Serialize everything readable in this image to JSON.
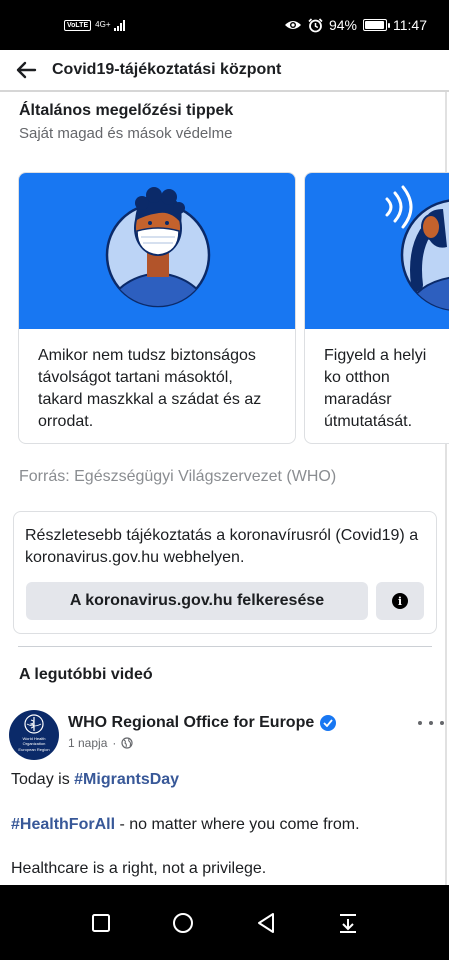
{
  "status_bar": {
    "volte": "VoLTE",
    "network": "4G+",
    "battery": "94%",
    "battery_level": 0.94,
    "time": "11:47"
  },
  "header": {
    "title": "Covid19-tájékoztatási központ",
    "back_icon": "arrow-left-icon"
  },
  "prevention": {
    "title": "Általános megelőzési tippek",
    "subtitle": "Saját magad és mások védelme",
    "cards": [
      {
        "text": "Amikor nem tudsz biztonságos távolságot tartani másoktól, takard maszkkal a szádat és az orrodat.",
        "illustration": "masked-person"
      },
      {
        "text": "Figyeld a helyi ko otthon maradásr útmutatását.",
        "illustration": "person-listening"
      }
    ],
    "source": "Forrás: Egészségügyi Világszervezet (WHO)"
  },
  "info_box": {
    "text": "Részletesebb tájékoztatás a koronavírusról (Covid19) a koronavirus.gov.hu webhelyen.",
    "button_label": "A koronavirus.gov.hu felkeresése",
    "info_icon": "info-icon"
  },
  "latest_video": {
    "title": "A legutóbbi videó",
    "post": {
      "author": "WHO Regional Office for Europe",
      "avatar_lines": [
        "World Health",
        "Organization",
        "European Region"
      ],
      "time": "1 napja",
      "visibility_icon": "globe-icon",
      "line1_prefix": "Today is ",
      "line1_tag": "#MigrantsDay",
      "line2_tag": "#HealthForAll",
      "line2_suffix": " - no matter where you come from.",
      "line3": "Healthcare is a right, not a privilege."
    }
  },
  "nav_bar": {
    "icons": [
      "square-recents-icon",
      "circle-home-icon",
      "triangle-back-icon",
      "notification-pulldown-icon"
    ]
  },
  "colors": {
    "brand_blue": "#1877f2",
    "hashtag": "#385898",
    "secondary_text": "#65676b",
    "who_navy": "#0b2a69"
  }
}
